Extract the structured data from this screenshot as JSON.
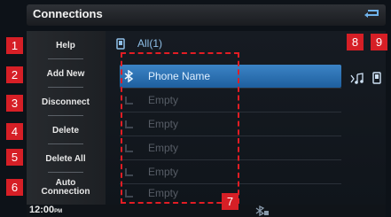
{
  "title_bar": {
    "title": "Connections",
    "back_icon": "back-arrow-icon"
  },
  "menu": [
    {
      "label": "Help"
    },
    {
      "label": "Add New"
    },
    {
      "label": "Disconnect"
    },
    {
      "label": "Delete"
    },
    {
      "label": "Delete All"
    },
    {
      "label": "Auto\nConnection"
    }
  ],
  "list": {
    "header": "All(1)",
    "rows": [
      {
        "label": "Phone Name",
        "state": "connected"
      },
      {
        "label": "Empty",
        "state": "empty"
      },
      {
        "label": "Empty",
        "state": "empty"
      },
      {
        "label": "Empty",
        "state": "empty"
      },
      {
        "label": "Empty",
        "state": "empty"
      },
      {
        "label": "Empty",
        "state": "empty"
      }
    ]
  },
  "status_bar": {
    "clock": "12:00",
    "clock_suffix": "PM"
  },
  "callouts": [
    "1",
    "2",
    "3",
    "4",
    "5",
    "6",
    "7",
    "8",
    "9"
  ],
  "colors": {
    "accent": "#2f77bd",
    "callout": "#d61f26"
  }
}
